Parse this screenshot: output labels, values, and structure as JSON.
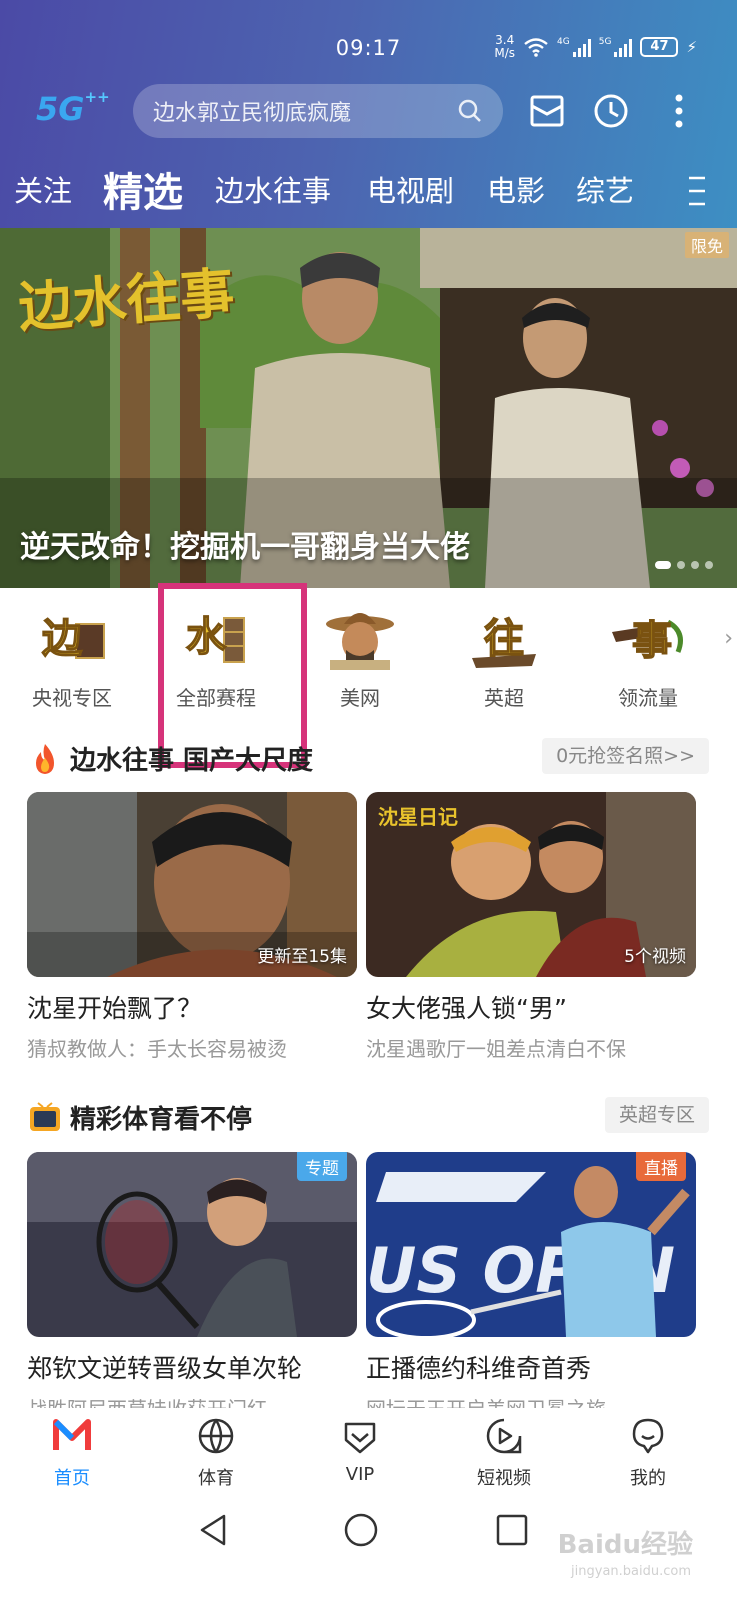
{
  "status": {
    "time": "09:17",
    "net_speed_value": "3.4",
    "net_speed_unit": "M/s",
    "sim1": "4G",
    "sim2": "5G",
    "battery": "47"
  },
  "search": {
    "placeholder": "边水郭立民彻底疯魔"
  },
  "logo": {
    "text": "5G",
    "sup": "++"
  },
  "tabs": [
    {
      "label": "关注"
    },
    {
      "label": "精选"
    },
    {
      "label": "边水往事"
    },
    {
      "label": "电视剧"
    },
    {
      "label": "电影"
    },
    {
      "label": "综艺"
    }
  ],
  "banner": {
    "title": "逆天改命！挖掘机一哥翻身当大佬",
    "badge": "限免",
    "logo_text": "边水往事"
  },
  "categories": [
    {
      "label": "央视专区",
      "glyph": "边"
    },
    {
      "label": "全部赛程",
      "glyph": "水"
    },
    {
      "label": "美网",
      "glyph": ""
    },
    {
      "label": "英超",
      "glyph": "往"
    },
    {
      "label": "领流量",
      "glyph": "事"
    }
  ],
  "section1": {
    "title": "边水往事 国产大尺度",
    "link": "0元抢签名照>>",
    "cards": [
      {
        "corner": "更新至15集",
        "title": "沈星开始飘了？",
        "sub": "猜叔教做人：手太长容易被烫"
      },
      {
        "corner": "5个视频",
        "img_text": "沈星日记",
        "title": "女大佬强人锁“男”",
        "sub": "沈星遇歌厅一姐差点清白不保"
      }
    ]
  },
  "section2": {
    "title": "精彩体育看不停",
    "link": "英超专区",
    "cards": [
      {
        "tag": "专题",
        "tag_color": "#4aa8ea",
        "title": "郑钦文逆转晋级女单次轮",
        "sub": "战胜阿尼西莫娃收获开门红"
      },
      {
        "tag": "直播",
        "tag_color": "#e86a3a",
        "img_text": "US OPEN",
        "title": "正播德约科维奇首秀",
        "sub": "网坛天王开启美网卫冕之旅"
      }
    ]
  },
  "bottom_nav": [
    {
      "label": "首页"
    },
    {
      "label": "体育"
    },
    {
      "label": "VIP"
    },
    {
      "label": "短视频"
    },
    {
      "label": "我的"
    }
  ],
  "watermark": {
    "text": "Baidu经验",
    "sub": "jingyan.baidu.com"
  },
  "colors": {
    "accent": "#1a8dff",
    "highlight": "#d6337a",
    "header_start": "#4b4aa6",
    "header_end": "#3d8fc3"
  }
}
